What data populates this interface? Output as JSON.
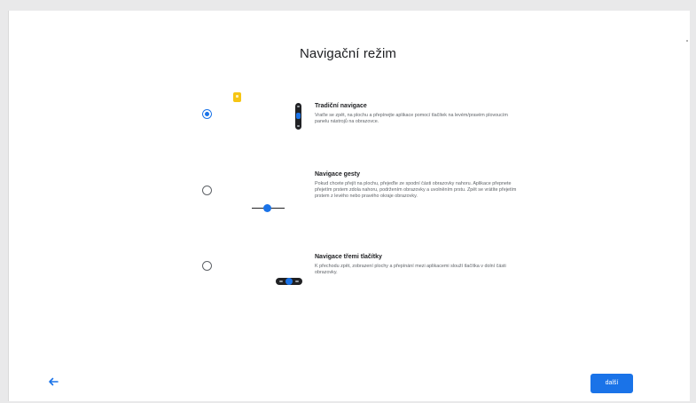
{
  "page": {
    "title": "Navigační režim"
  },
  "options": [
    {
      "title": "Tradiční navigace",
      "description": "Vraťte se zpět, na plochu a přepínejte aplikace pomocí tlačítek na levém/pravém plovoucím panelu nástrojů na obrazovce.",
      "selected": true
    },
    {
      "title": "Navigace gesty",
      "description": "Pokud chcete přejít na plochu, přejeďte ze spodní části obrazovky nahoru. Aplikace přepnete přejetím prstem zdola nahoru, podržením obrazovky a uvolněním prstu. Zpět se vrátíte přejetím prstem z levého nebo pravého okraje obrazovky.",
      "selected": false
    },
    {
      "title": "Navigace třemi tlačítky",
      "description": "K přechodu zpět, zobrazení plochy a přepínání mezi aplikacemi slouží tlačítka v dolní části obrazovky.",
      "selected": false
    }
  ],
  "footer": {
    "back_icon": "arrow-left-icon",
    "next_label": "další"
  },
  "colors": {
    "accent": "#1a73e8",
    "background": "#ffffff",
    "text": "#202124"
  }
}
